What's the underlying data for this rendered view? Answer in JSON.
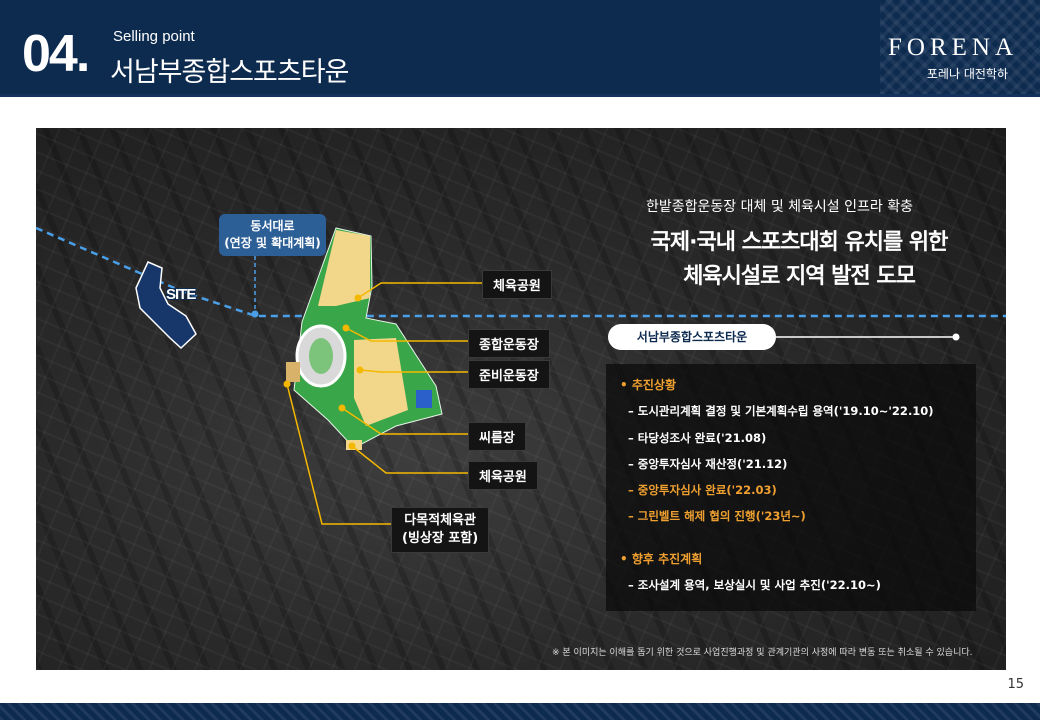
{
  "header": {
    "section_number": "04.",
    "section_label": "Selling point",
    "section_title": "서남부종합스포츠타운",
    "brand": "FORENA",
    "brand_sub": "포레나 대전학하"
  },
  "map": {
    "road_callout": [
      "동서대로",
      "(연장 및 확대계획)"
    ],
    "site_label": "SITE",
    "labels": {
      "park_top": "체육공원",
      "stadium": "종합운동장",
      "sub_stadium": "준비운동장",
      "ssireum": "씨름장",
      "park_bottom": "체육공원",
      "multi_gym": [
        "다목적체육관",
        "(빙상장 포함)"
      ]
    }
  },
  "headline": {
    "sub": "한밭종합운동장 대체 및 체육시설 인프라 확충",
    "main_line1": "국제·국내 스포츠대회 유치를 위한",
    "main_line2": "체육시설로 지역 발전 도모",
    "pill": "서남부종합스포츠타운"
  },
  "info": {
    "progress_title": "• 추진상황",
    "progress_items": [
      "– 도시관리계획 결정 및 기본계획수립 용역('19.10~'22.10)",
      "– 타당성조사 완료('21.08)",
      "– 중앙투자심사 재산정('21.12)",
      "– 중앙투자심사 완료('22.03)",
      "– 그린벨트 해제 협의 진행('23년~)"
    ],
    "future_title": "• 향후 추진계획",
    "future_items": [
      "– 조사설계 용역, 보상실시 및 사업 추진('22.10~)"
    ]
  },
  "disclaimer": "※ 본 이미지는 이해를 돕기 위한 것으로 사업진행과정 및 관계기관의 사정에 따라 변동 또는 취소될 수 있습니다.",
  "page_number": "15",
  "colors": {
    "navy": "#0d2a4f",
    "callout_blue": "#2d5f97",
    "highlight_orange": "#f0a030",
    "leader_line": "#f5b800"
  }
}
